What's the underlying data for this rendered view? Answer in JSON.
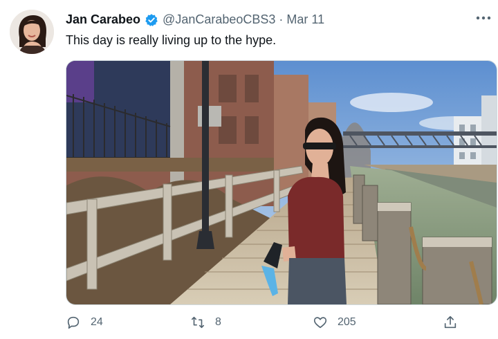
{
  "tweet": {
    "author_name": "Jan Carabeo",
    "handle": "@JanCarabeoCBS3",
    "separator": "·",
    "date": "Mar 11",
    "text": "This day is really living up to the hype.",
    "more_icon": "more-horizontal-icon"
  },
  "actions": {
    "reply_count": "24",
    "retweet_count": "8",
    "like_count": "205",
    "reply_icon": "reply-icon",
    "retweet_icon": "retweet-icon",
    "like_icon": "heart-icon",
    "share_icon": "share-icon"
  },
  "colors": {
    "verified_badge": "#1d9bf0",
    "secondary_text": "#536471"
  }
}
